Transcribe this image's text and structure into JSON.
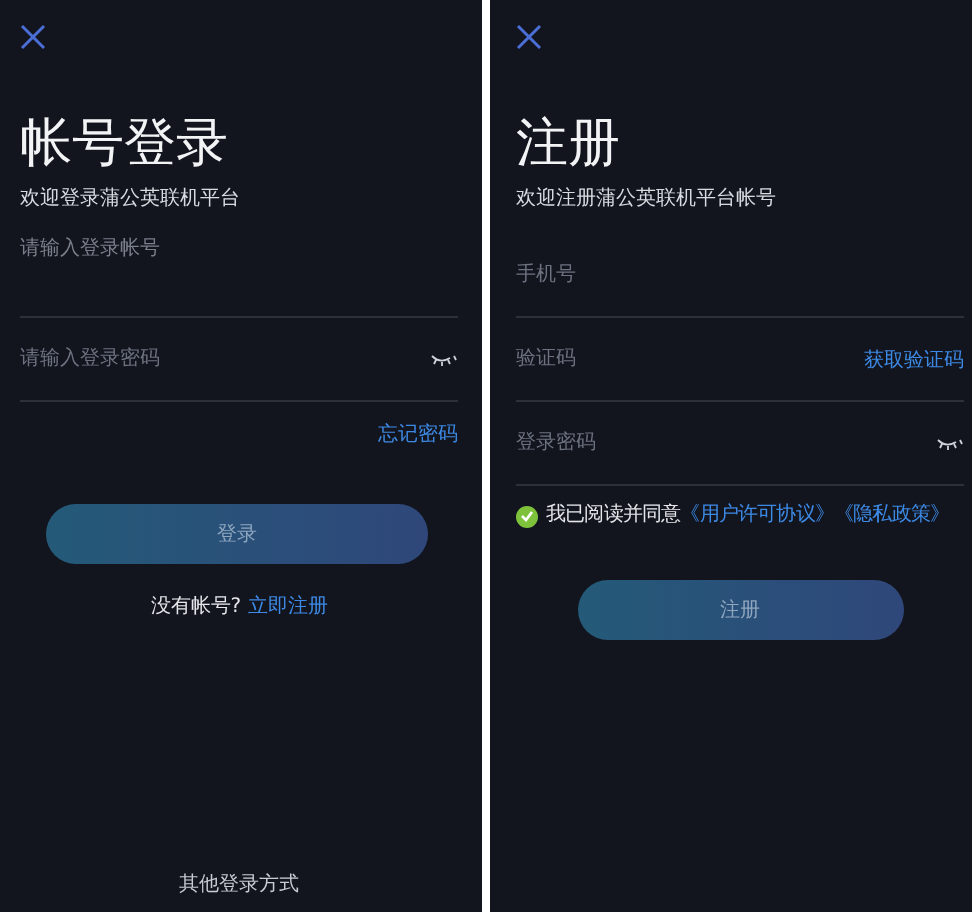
{
  "login": {
    "title": "帐号登录",
    "subtitle": "欢迎登录蒲公英联机平台",
    "account_label": "请输入登录帐号",
    "password_placeholder": "请输入登录密码",
    "forgot_link": "忘记密码",
    "submit_button": "登录",
    "signup_prompt": {
      "text": "没有帐号? ",
      "link": "立即注册"
    },
    "footer": "其他登录方式"
  },
  "register": {
    "title": "注册",
    "subtitle": "欢迎注册蒲公英联机平台帐号",
    "fields": [
      {
        "kind": "text",
        "placeholder": "手机号"
      },
      {
        "kind": "code",
        "placeholder": "验证码",
        "action": "获取验证码"
      },
      {
        "kind": "password",
        "placeholder": "登录密码"
      }
    ],
    "agreement": {
      "checked": true,
      "text": "我已阅读并同意",
      "links": [
        "《用户许可协议》",
        "《隐私政策》"
      ]
    },
    "submit_button": "注册"
  }
}
